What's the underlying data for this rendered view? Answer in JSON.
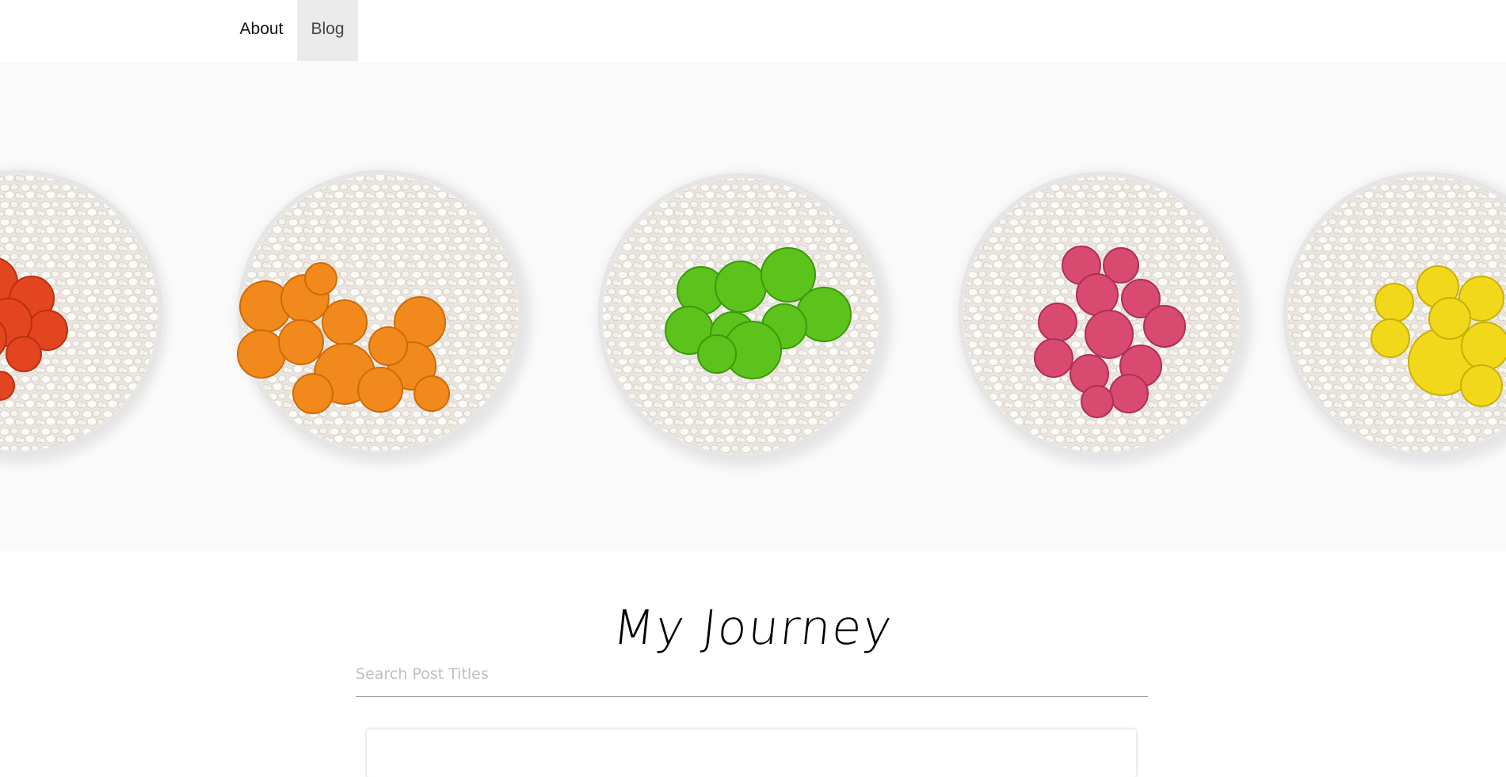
{
  "nav": {
    "items": [
      {
        "label": "About",
        "active": false
      },
      {
        "label": "Blog",
        "active": true
      }
    ]
  },
  "hero": {
    "image": "five white pots of white pebbles with colored cacti viewed from above",
    "cactus_colors": [
      "#e2451f",
      "#f2891c",
      "#5cc21c",
      "#d94a70",
      "#f1d81a"
    ]
  },
  "page": {
    "title": "My Journey"
  },
  "search": {
    "placeholder": "Search Post Titles",
    "value": ""
  },
  "colors": {
    "nav_active_bg": "#ebebeb",
    "search_underline": "#9a9a9a"
  }
}
